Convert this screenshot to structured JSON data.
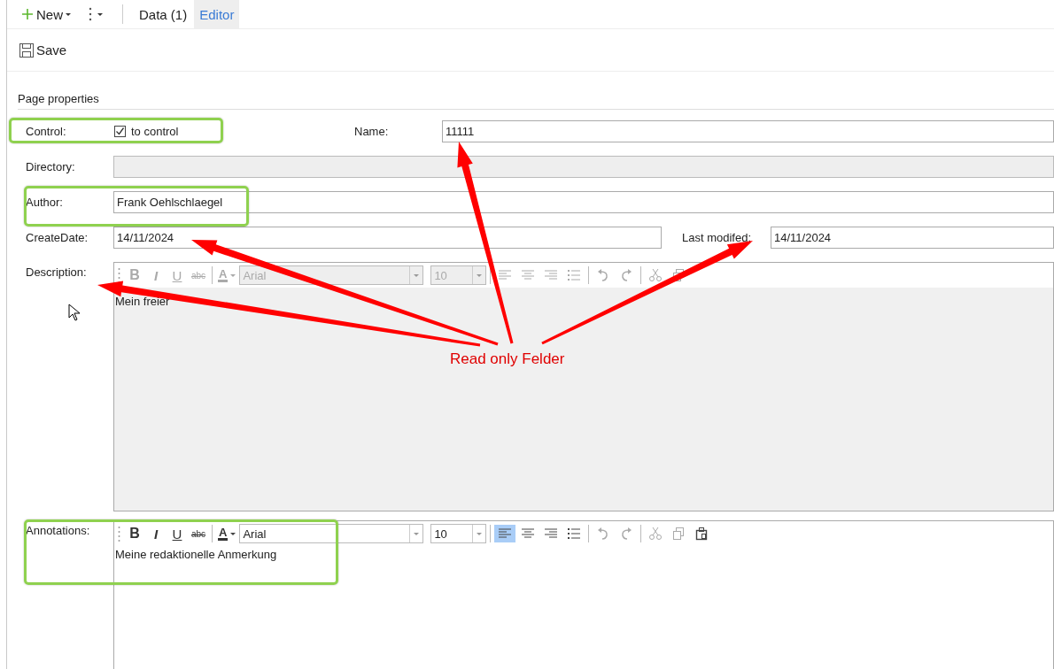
{
  "toolbar": {
    "new_label": "New",
    "tabs": [
      {
        "label": "Data (1)",
        "selected": false
      },
      {
        "label": "Editor",
        "selected": true
      }
    ]
  },
  "actions": {
    "save_label": "Save"
  },
  "section": {
    "title": "Page properties"
  },
  "rows": [
    {
      "kind": "checkbox",
      "label": "Control:",
      "checked": true,
      "text": "to control",
      "side": {
        "label": "Name:",
        "value": "11111",
        "disabled": false
      }
    },
    {
      "kind": "text",
      "label": "Directory:",
      "disabled": true
    },
    {
      "kind": "text",
      "label": "Author:",
      "value": "Frank Oehlschlaegel",
      "disabled": false
    },
    {
      "kind": "text",
      "label": "CreateDate:",
      "value": "14/11/2024",
      "disabled": false,
      "side": {
        "label": "Last modifed:",
        "value": "14/11/2024",
        "disabled": false
      }
    },
    {
      "kind": "editor",
      "label": "Description:",
      "disabled": true,
      "format_buttons": [
        "B",
        "I",
        "U",
        "abc"
      ],
      "color_button": "A",
      "font": "Arial",
      "size": "10",
      "align_left_active": false,
      "text": "Mein freier"
    },
    {
      "kind": "editor",
      "label": "Annotations:",
      "disabled": false,
      "format_buttons": [
        "B",
        "I",
        "U",
        "abc"
      ],
      "color_button": "A",
      "font": "Arial",
      "size": "10",
      "align_left_active": true,
      "text": "Meine redaktionelle Anmerkung"
    }
  ],
  "callout": {
    "text": "Read only Felder"
  }
}
